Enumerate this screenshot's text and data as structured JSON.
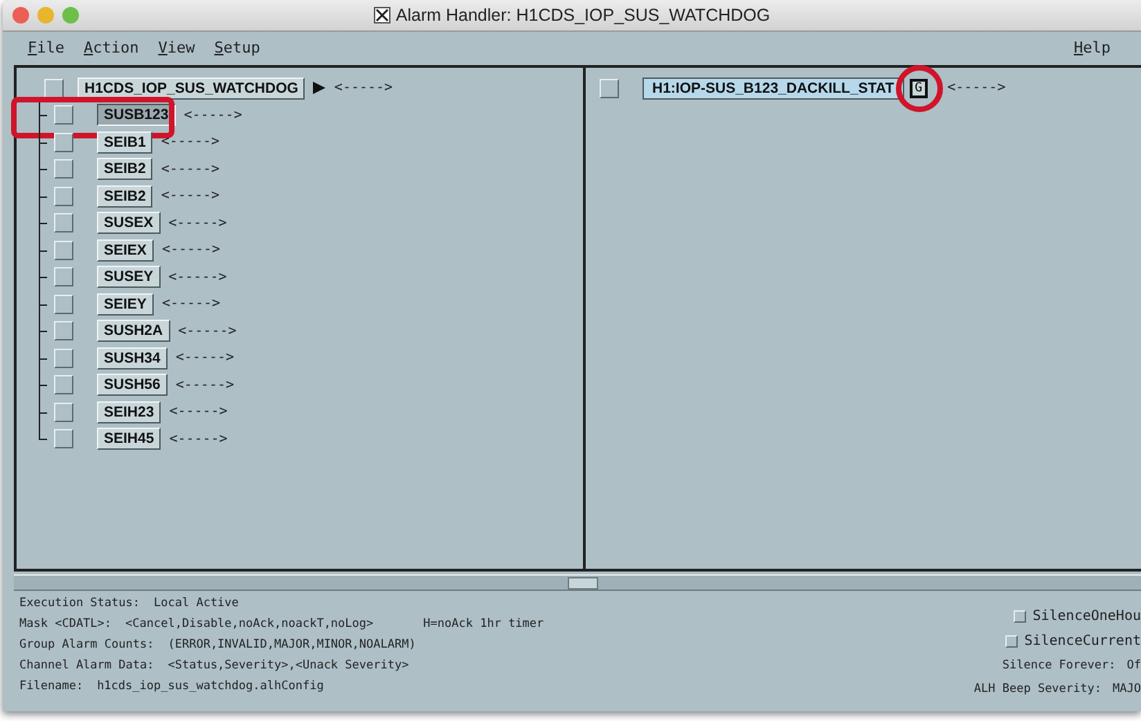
{
  "window": {
    "title": "Alarm Handler: H1CDS_IOP_SUS_WATCHDOG"
  },
  "menu": [
    {
      "label": "File"
    },
    {
      "label": "Action"
    },
    {
      "label": "View"
    },
    {
      "label": "Setup"
    }
  ],
  "help_menu": {
    "label": "Help"
  },
  "group_tree": {
    "name": "H1CDS_IOP_SUS_WATCHDOG",
    "selected": false,
    "highlighted": false,
    "status": "<----->",
    "has_subgroups": true,
    "children": [
      {
        "name": "SUSB123",
        "selected": true,
        "highlighted": true,
        "status": "<----->"
      },
      {
        "name": "SEIB1",
        "selected": false,
        "highlighted": false,
        "status": "<----->"
      },
      {
        "name": "SEIB2",
        "selected": false,
        "highlighted": false,
        "status": "<----->"
      },
      {
        "name": "SEIB2",
        "selected": false,
        "highlighted": false,
        "status": "<----->"
      },
      {
        "name": "SUSEX",
        "selected": false,
        "highlighted": false,
        "status": "<----->"
      },
      {
        "name": "SEIEX",
        "selected": false,
        "highlighted": false,
        "status": "<----->"
      },
      {
        "name": "SUSEY",
        "selected": false,
        "highlighted": false,
        "status": "<----->"
      },
      {
        "name": "SEIEY",
        "selected": false,
        "highlighted": false,
        "status": "<----->"
      },
      {
        "name": "SUSH2A",
        "selected": false,
        "highlighted": false,
        "status": "<----->"
      },
      {
        "name": "SUSH34",
        "selected": false,
        "highlighted": false,
        "status": "<----->"
      },
      {
        "name": "SUSH56",
        "selected": false,
        "highlighted": false,
        "status": "<----->"
      },
      {
        "name": "SEIH23",
        "selected": false,
        "highlighted": false,
        "status": "<----->"
      },
      {
        "name": "SEIH45",
        "selected": false,
        "highlighted": false,
        "status": "<----->"
      }
    ]
  },
  "channels": [
    {
      "name": "H1:IOP-SUS_B123_DACKILL_STAT",
      "guidance": "G",
      "guidance_highlighted": true,
      "status": "<----->"
    }
  ],
  "status_lines": [
    {
      "label": "Execution Status:",
      "value": "Local Active"
    },
    {
      "label": "Mask <CDATL>:",
      "value": "<Cancel,Disable,noAck,noackT,noLog>",
      "note": "H=noAck 1hr timer"
    },
    {
      "label": "Group Alarm Counts:",
      "value": "(ERROR,INVALID,MAJOR,MINOR,NOALARM)"
    },
    {
      "label": "Channel Alarm Data:",
      "value": "<Status,Severity>,<Unack Severity>"
    },
    {
      "label": "Filename:",
      "value": "h1cds_iop_sus_watchdog.alhConfig"
    }
  ],
  "silence_options": [
    {
      "label": "SilenceOneHou",
      "checked": false
    },
    {
      "label": "SilenceCurrent",
      "checked": false
    }
  ],
  "settings": [
    {
      "label": "Silence Forever:",
      "value": "Of"
    },
    {
      "label": "ALH Beep Severity:",
      "value": "MAJO"
    }
  ]
}
